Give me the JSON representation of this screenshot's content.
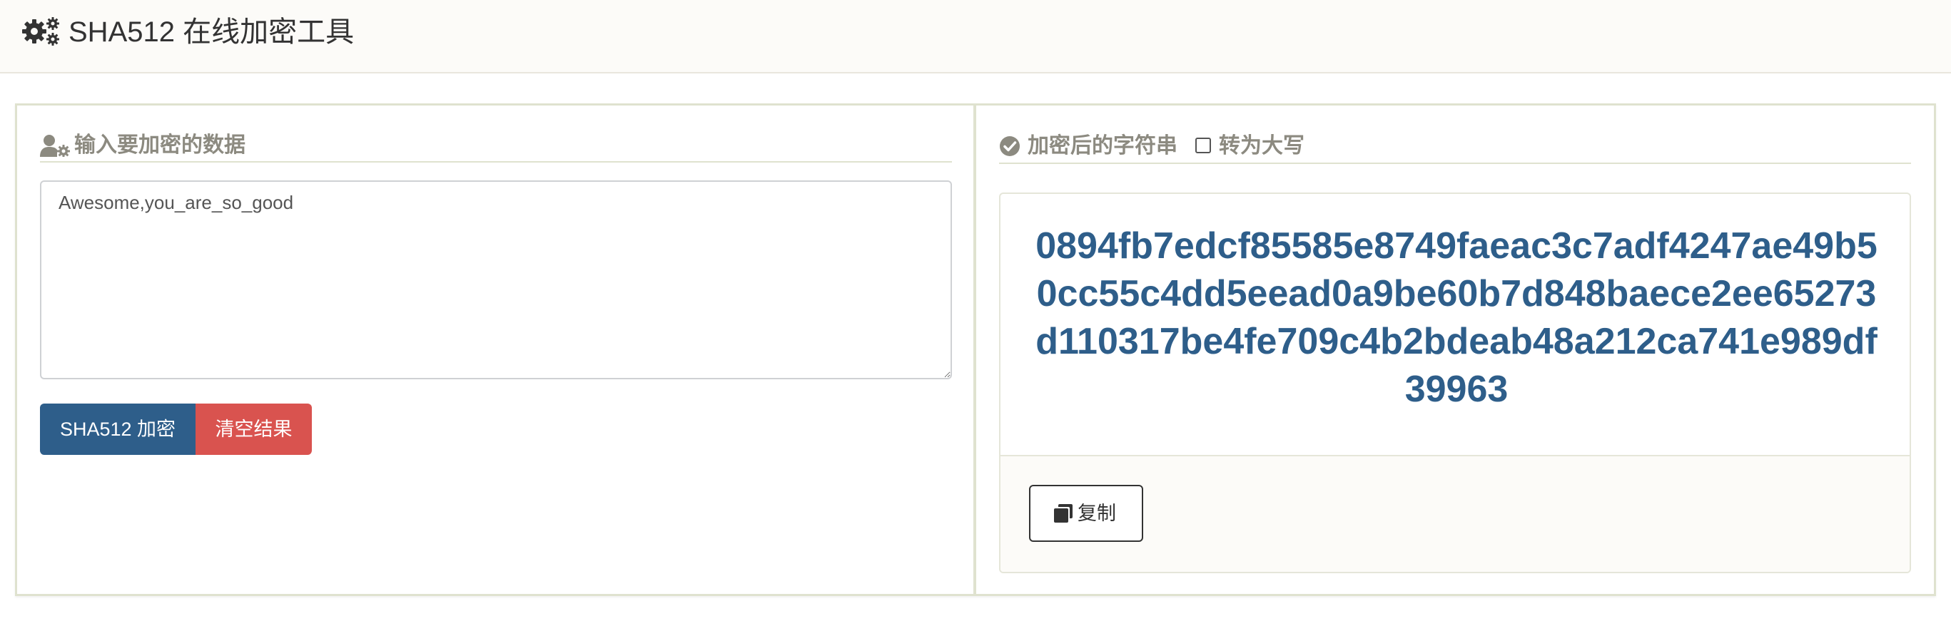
{
  "header": {
    "title": "SHA512 在线加密工具",
    "icon": "gears-icon"
  },
  "input_panel": {
    "heading": "输入要加密的数据",
    "heading_icon": "user-cog-icon",
    "input_value": "Awesome,you_are_so_good",
    "encrypt_button": "SHA512 加密",
    "clear_button": "清空结果"
  },
  "output_panel": {
    "heading": "加密后的字符串",
    "heading_icon": "check-circle-icon",
    "uppercase_label": "转为大写",
    "uppercase_checked": false,
    "result": "0894fb7edcf85585e8749faeac3c7adf4247ae49b50cc55c4dd5eead0a9be60b7d848baece2ee65273d110317be4fe709c4b2bdeab48a212ca741e989df39963",
    "copy_button": "复制",
    "copy_icon": "copy-icon"
  },
  "colors": {
    "primary": "#2e5e8a",
    "danger": "#d9534f",
    "heading_text": "#8c8a80",
    "panel_border": "#dfe2cf",
    "topbar_bg": "#fcfbf8"
  }
}
